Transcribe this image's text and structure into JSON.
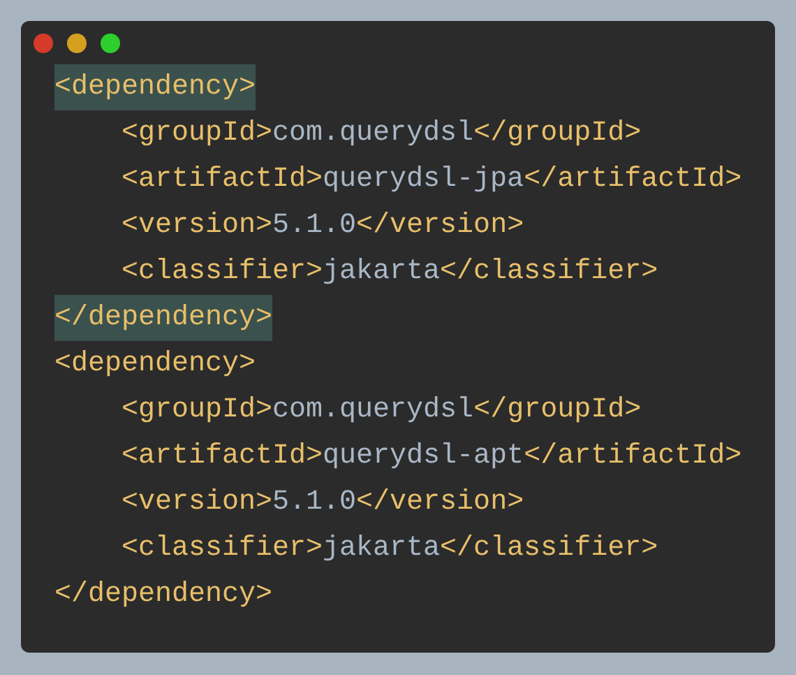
{
  "window": {
    "controls": [
      {
        "kind": "close"
      },
      {
        "kind": "minimize"
      },
      {
        "kind": "maximize"
      }
    ]
  },
  "code": [
    {
      "highlighted": true,
      "tokens": [
        {
          "kind": "tag",
          "text": "<dependency>"
        }
      ],
      "children": [
        {
          "highlighted": false,
          "tokens": [
            {
              "kind": "tag",
              "text": "<groupId>"
            },
            {
              "kind": "text",
              "text": "com.querydsl"
            },
            {
              "kind": "tag",
              "text": "</groupId>"
            }
          ]
        },
        {
          "highlighted": false,
          "tokens": [
            {
              "kind": "tag",
              "text": "<artifactId>"
            },
            {
              "kind": "text",
              "text": "querydsl-jpa"
            },
            {
              "kind": "tag",
              "text": "</artifactId>"
            }
          ]
        },
        {
          "highlighted": false,
          "tokens": [
            {
              "kind": "tag",
              "text": "<version>"
            },
            {
              "kind": "text",
              "text": "5.1.0"
            },
            {
              "kind": "tag",
              "text": "</version>"
            }
          ]
        },
        {
          "highlighted": false,
          "tokens": [
            {
              "kind": "tag",
              "text": "<classifier>"
            },
            {
              "kind": "text",
              "text": "jakarta"
            },
            {
              "kind": "tag",
              "text": "</classifier>"
            }
          ]
        }
      ]
    },
    {
      "highlighted": true,
      "tokens": [
        {
          "kind": "tag",
          "text": "</dependency>"
        }
      ]
    },
    {
      "highlighted": false,
      "tokens": [
        {
          "kind": "tag",
          "text": "<dependency>"
        }
      ],
      "children": [
        {
          "highlighted": false,
          "tokens": [
            {
              "kind": "tag",
              "text": "<groupId>"
            },
            {
              "kind": "text",
              "text": "com.querydsl"
            },
            {
              "kind": "tag",
              "text": "</groupId>"
            }
          ]
        },
        {
          "highlighted": false,
          "tokens": [
            {
              "kind": "tag",
              "text": "<artifactId>"
            },
            {
              "kind": "text",
              "text": "querydsl-apt"
            },
            {
              "kind": "tag",
              "text": "</artifactId>"
            }
          ]
        },
        {
          "highlighted": false,
          "tokens": [
            {
              "kind": "tag",
              "text": "<version>"
            },
            {
              "kind": "text",
              "text": "5.1.0"
            },
            {
              "kind": "tag",
              "text": "</version>"
            }
          ]
        },
        {
          "highlighted": false,
          "tokens": [
            {
              "kind": "tag",
              "text": "<classifier>"
            },
            {
              "kind": "text",
              "text": "jakarta"
            },
            {
              "kind": "tag",
              "text": "</classifier>"
            }
          ]
        }
      ]
    },
    {
      "highlighted": false,
      "tokens": [
        {
          "kind": "tag",
          "text": "</dependency>"
        }
      ]
    }
  ]
}
